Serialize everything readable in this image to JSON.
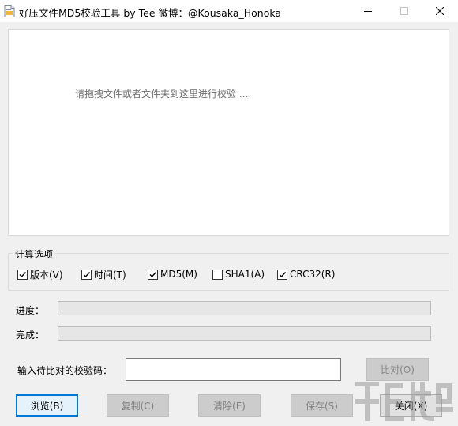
{
  "window": {
    "title": "好压文件MD5校验工具 by Tee    微博：@Kousaka_Honoka",
    "controls": [
      "minimize-icon",
      "maximize-icon",
      "close-icon"
    ]
  },
  "drop_area": {
    "hint": "请拖拽文件或者文件夹到这里进行校验 ..."
  },
  "options": {
    "group_label": "计算选项",
    "items": [
      {
        "label": "版本(V)",
        "checked": true
      },
      {
        "label": "时间(T)",
        "checked": true
      },
      {
        "label": "MD5(M)",
        "checked": true
      },
      {
        "label": "SHA1(A)",
        "checked": false
      },
      {
        "label": "CRC32(R)",
        "checked": true
      }
    ]
  },
  "progress": {
    "label": "进度：",
    "value": 0
  },
  "complete": {
    "label": "完成：",
    "value": 0
  },
  "compare": {
    "label": "输入待比对的校验码：",
    "input_value": "",
    "button_label": "比对(O)"
  },
  "buttons": {
    "browse": "浏览(B)",
    "copy": "复制(C)",
    "clear": "清除(E)",
    "save": "保存(S)",
    "close": "关闭(X)"
  },
  "colors": {
    "accent": "#0078d7",
    "drop_bg": "#ffffff",
    "window_bg": "#f0f0f0",
    "hint_text": "#6d6d6d"
  }
}
